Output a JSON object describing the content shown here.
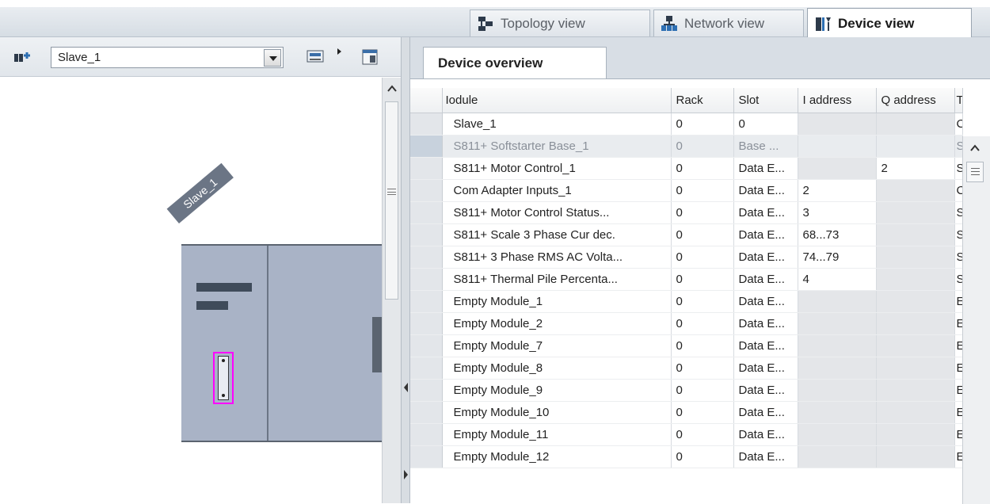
{
  "view_tabs": [
    {
      "label": "Topology view",
      "icon": "topology-icon",
      "active": false
    },
    {
      "label": "Network view",
      "icon": "network-icon",
      "active": false
    },
    {
      "label": "Device view",
      "icon": "device-icon",
      "active": true
    }
  ],
  "left_toolbar": {
    "device_select_value": "Slave_1"
  },
  "canvas": {
    "device_label": "Slave_1"
  },
  "overview": {
    "tab_label": "Device overview",
    "columns": [
      "Iodule",
      "Rack",
      "Slot",
      "I address",
      "Q address",
      "T"
    ],
    "rows": [
      {
        "module": "Slave_1",
        "rack": "0",
        "slot": "0",
        "i_address": "",
        "q_address": "",
        "type": "C",
        "dim": false
      },
      {
        "module": "S811+ Softstarter Base_1",
        "rack": "0",
        "slot": "Base ...",
        "i_address": "",
        "q_address": "",
        "type": "S",
        "dim": true
      },
      {
        "module": "S811+ Motor Control_1",
        "rack": "0",
        "slot": "Data E...",
        "i_address": "",
        "q_address": "2",
        "type": "S",
        "dim": false
      },
      {
        "module": "Com Adapter Inputs_1",
        "rack": "0",
        "slot": "Data E...",
        "i_address": "2",
        "q_address": "",
        "type": "C",
        "dim": false
      },
      {
        "module": "S811+ Motor Control Status...",
        "rack": "0",
        "slot": "Data E...",
        "i_address": "3",
        "q_address": "",
        "type": "S",
        "dim": false
      },
      {
        "module": "S811+ Scale 3 Phase Cur dec.",
        "rack": "0",
        "slot": "Data E...",
        "i_address": "68...73",
        "q_address": "",
        "type": "S",
        "dim": false
      },
      {
        "module": "S811+ 3 Phase RMS AC Volta...",
        "rack": "0",
        "slot": "Data E...",
        "i_address": "74...79",
        "q_address": "",
        "type": "S",
        "dim": false
      },
      {
        "module": "S811+ Thermal Pile Percenta...",
        "rack": "0",
        "slot": "Data E...",
        "i_address": "4",
        "q_address": "",
        "type": "S",
        "dim": false
      },
      {
        "module": "Empty Module_1",
        "rack": "0",
        "slot": "Data E...",
        "i_address": "",
        "q_address": "",
        "type": "E",
        "dim": false
      },
      {
        "module": "Empty Module_2",
        "rack": "0",
        "slot": "Data E...",
        "i_address": "",
        "q_address": "",
        "type": "E",
        "dim": false
      },
      {
        "module": "Empty Module_7",
        "rack": "0",
        "slot": "Data E...",
        "i_address": "",
        "q_address": "",
        "type": "E",
        "dim": false
      },
      {
        "module": "Empty Module_8",
        "rack": "0",
        "slot": "Data E...",
        "i_address": "",
        "q_address": "",
        "type": "E",
        "dim": false
      },
      {
        "module": "Empty Module_9",
        "rack": "0",
        "slot": "Data E...",
        "i_address": "",
        "q_address": "",
        "type": "E",
        "dim": false
      },
      {
        "module": "Empty Module_10",
        "rack": "0",
        "slot": "Data E...",
        "i_address": "",
        "q_address": "",
        "type": "E",
        "dim": false
      },
      {
        "module": "Empty Module_11",
        "rack": "0",
        "slot": "Data E...",
        "i_address": "",
        "q_address": "",
        "type": "E",
        "dim": false
      },
      {
        "module": "Empty Module_12",
        "rack": "0",
        "slot": "Data E...",
        "i_address": "",
        "q_address": "",
        "type": "E",
        "dim": false
      }
    ]
  }
}
